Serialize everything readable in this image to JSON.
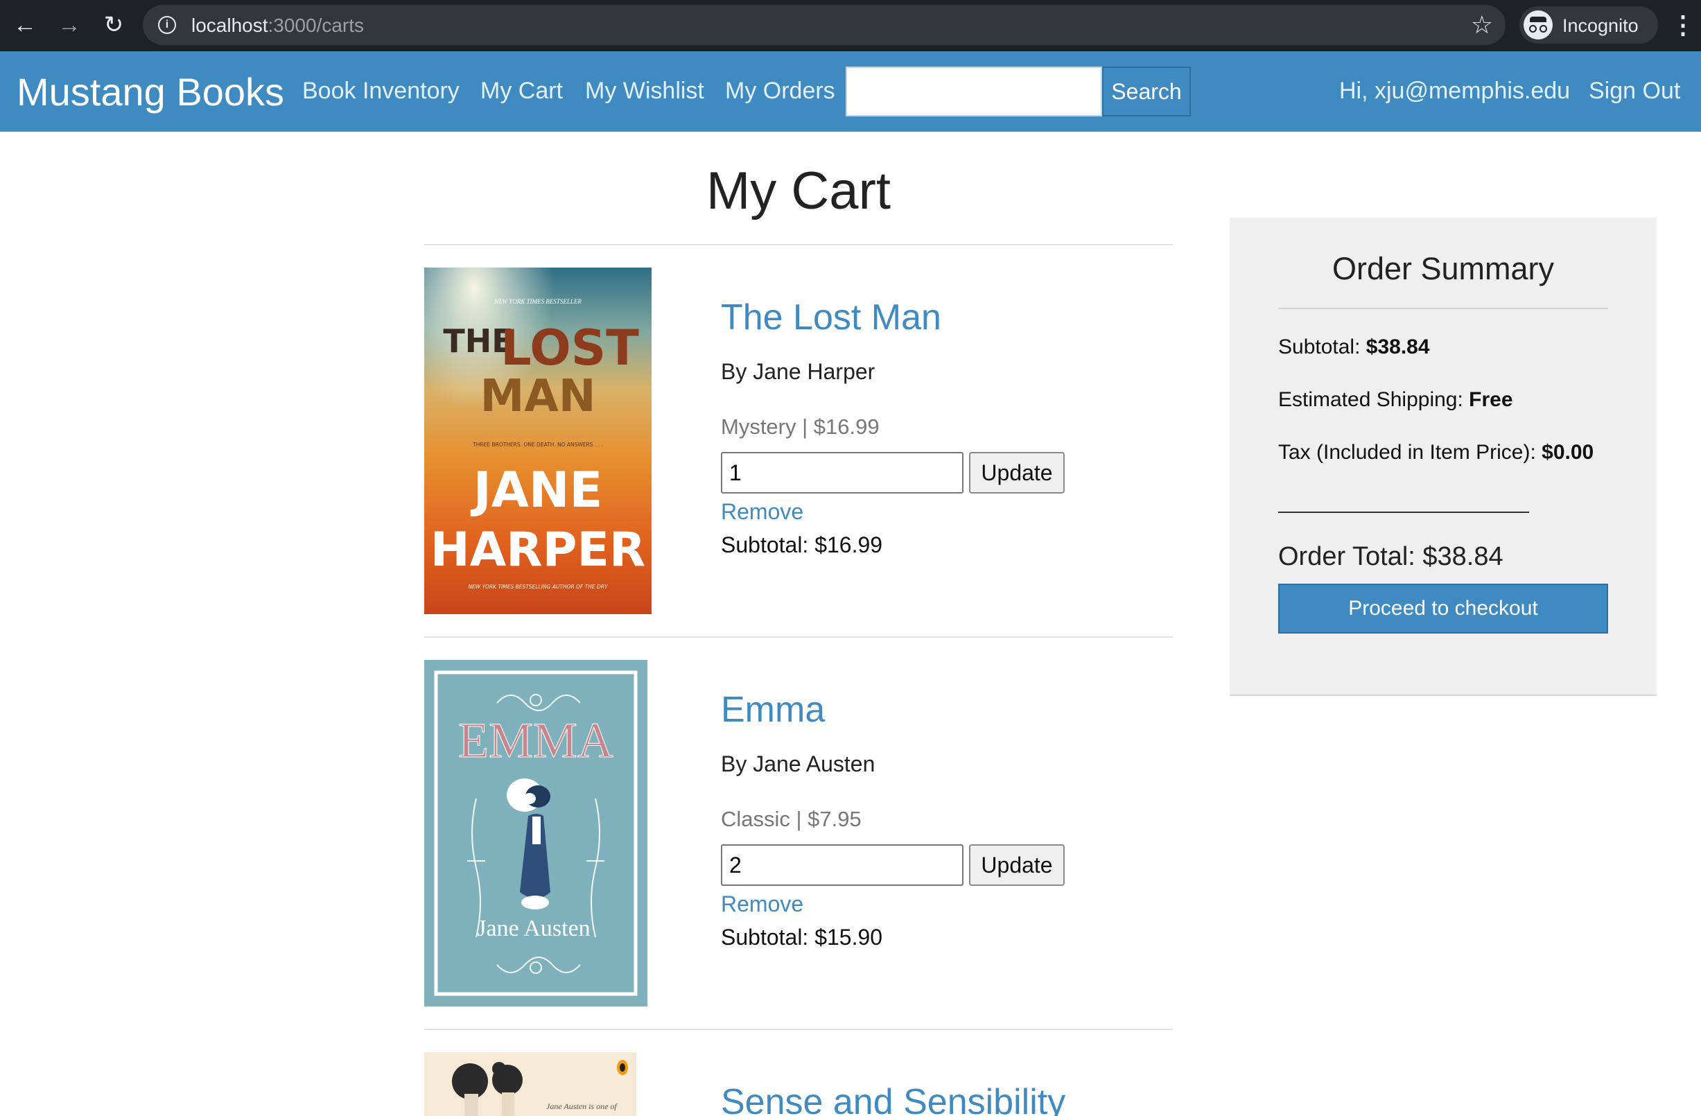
{
  "browser": {
    "url_host": "localhost",
    "url_path": ":3000/carts",
    "profile_label": "Incognito"
  },
  "navbar": {
    "brand": "Mustang Books",
    "links": [
      "Book Inventory",
      "My Cart",
      "My Wishlist",
      "My Orders"
    ],
    "search_value": "",
    "search_button": "Search",
    "greeting": "Hi, xju@memphis.edu",
    "sign_out": "Sign Out"
  },
  "page": {
    "title": "My Cart"
  },
  "cart": {
    "items": [
      {
        "title": "The Lost Man",
        "author": "By Jane Harper",
        "meta": "Mystery | $16.99",
        "quantity": "1",
        "update_label": "Update",
        "remove_label": "Remove",
        "subtotal": "Subtotal: $16.99",
        "cover": {
          "top_line": "NEW YORK TIMES BESTSELLER",
          "title_1": "THE",
          "title_2": "LOST",
          "title_3": "MAN",
          "tagline": "THREE BROTHERS. ONE DEATH. NO ANSWERS . . .",
          "author_1": "JANE",
          "author_2": "HARPER",
          "bottom_line": "NEW YORK TIMES BESTSELLING AUTHOR OF THE DRY"
        }
      },
      {
        "title": "Emma",
        "author": "By Jane Austen",
        "meta": "Classic | $7.95",
        "quantity": "2",
        "update_label": "Update",
        "remove_label": "Remove",
        "subtotal": "Subtotal: $15.90",
        "cover": {
          "title": "EMMA",
          "author": "Jane Austen"
        }
      },
      {
        "title": "Sense and Sensibility",
        "cover": {
          "blurb": "Jane Austen is one of"
        }
      }
    ]
  },
  "summary": {
    "title": "Order Summary",
    "subtotal_label": "Subtotal:",
    "subtotal_value": "$38.84",
    "shipping_label": "Estimated Shipping:",
    "shipping_value": "Free",
    "tax_label": "Tax (Included in Item Price):",
    "tax_value": "$0.00",
    "order_total": "Order Total: $38.84",
    "checkout_label": "Proceed to checkout"
  },
  "colors": {
    "brand_blue": "#3e8ac1",
    "chrome_dark": "#202124",
    "summary_bg": "#efefef"
  }
}
